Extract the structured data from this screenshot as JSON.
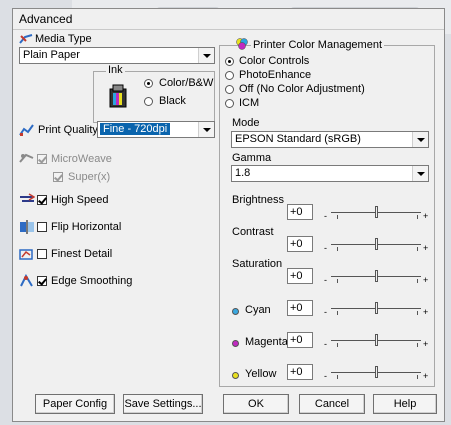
{
  "window": {
    "title": "Advanced"
  },
  "media_type": {
    "label": "Media Type",
    "value": "Plain Paper"
  },
  "ink": {
    "label": "Ink",
    "options": [
      "Color/B&W",
      "Black"
    ],
    "selected": "Color/B&W"
  },
  "print_quality": {
    "label": "Print Quality",
    "value": "Fine - 720dpi"
  },
  "options": {
    "microweave": "MicroWeave",
    "super": "Super(x)",
    "high_speed": "High Speed",
    "flip_horizontal": "Flip Horizontal",
    "finest_detail": "Finest Detail",
    "edge_smoothing": "Edge Smoothing"
  },
  "printer_color_management": {
    "label": "Printer Color Management",
    "options": [
      "Color Controls",
      "PhotoEnhance",
      "Off (No Color Adjustment)",
      "ICM"
    ],
    "selected": "Color Controls"
  },
  "mode": {
    "label": "Mode",
    "value": "EPSON Standard (sRGB)"
  },
  "gamma": {
    "label": "Gamma",
    "value": "1.8"
  },
  "adjustments": [
    {
      "label": "Brightness",
      "value": "+0",
      "level": 0.5
    },
    {
      "label": "Contrast",
      "value": "+0",
      "level": 0.5
    },
    {
      "label": "Saturation",
      "value": "+0",
      "level": 0.5
    },
    {
      "label": "Cyan",
      "value": "+0",
      "level": 0.5,
      "color": "#3aa8e0"
    },
    {
      "label": "Magenta",
      "value": "+0",
      "level": 0.5,
      "color": "#c02ac0"
    },
    {
      "label": "Yellow",
      "value": "+0",
      "level": 0.5,
      "color": "#e8e020"
    }
  ],
  "slider_minus": "-",
  "slider_plus": "+",
  "buttons": {
    "paper_config": "Paper Config",
    "save_settings": "Save Settings...",
    "ok": "OK",
    "cancel": "Cancel",
    "help": "Help"
  }
}
